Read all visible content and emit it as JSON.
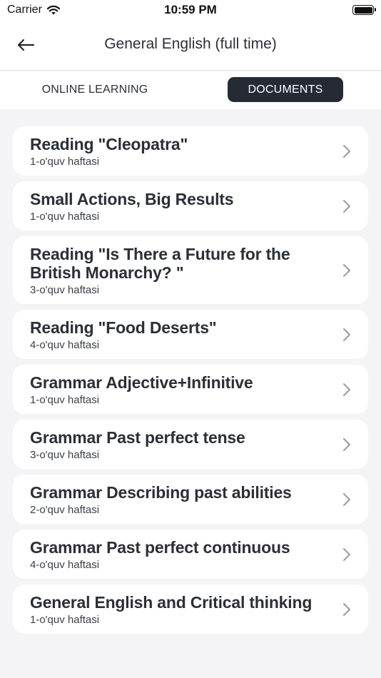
{
  "status_bar": {
    "carrier": "Carrier",
    "time": "10:59 PM"
  },
  "header": {
    "title": "General English (full time)"
  },
  "tabs": [
    {
      "label": "ONLINE LEARNING",
      "active": false
    },
    {
      "label": "DOCUMENTS",
      "active": true
    }
  ],
  "documents": [
    {
      "title": "Reading \"Cleopatra\"",
      "week": "1-o'quv haftasi"
    },
    {
      "title": "Small Actions, Big Results",
      "week": "1-o'quv haftasi"
    },
    {
      "title": "Reading \"Is There a Future for the British Monarchy? \"",
      "week": "3-o'quv haftasi"
    },
    {
      "title": "Reading \"Food Deserts\"",
      "week": "4-o'quv haftasi"
    },
    {
      "title": "Grammar Adjective+Infinitive",
      "week": "1-o'quv haftasi"
    },
    {
      "title": "Grammar Past perfect tense",
      "week": "3-o'quv haftasi"
    },
    {
      "title": "Grammar Describing past abilities",
      "week": "2-o'quv haftasi"
    },
    {
      "title": "Grammar Past perfect continuous",
      "week": "4-o'quv haftasi"
    },
    {
      "title": "General English and Critical thinking",
      "week": "1-o'quv haftasi"
    }
  ],
  "colors": {
    "accent_dark": "#252a35",
    "background": "#f4f4f6",
    "card": "#ffffff",
    "chevron": "#9a9ca2"
  },
  "icons": {
    "back": "arrow-left-icon",
    "chevron": "chevron-right-icon",
    "wifi": "wifi-icon",
    "battery": "battery-icon"
  }
}
